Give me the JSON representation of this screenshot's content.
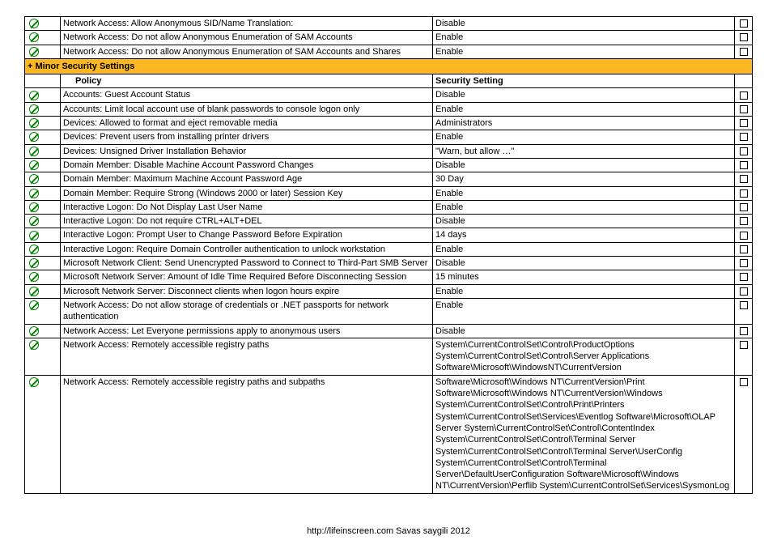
{
  "topRows": [
    {
      "policy": "Network Access: Allow Anonymous SID/Name Translation:",
      "setting": "Disable"
    },
    {
      "policy": "Network Access: Do not allow Anonymous Enumeration of SAM Accounts",
      "setting": "Enable"
    },
    {
      "policy": "Network Access: Do not allow Anonymous Enumeration of SAM Accounts and Shares",
      "setting": "Enable"
    }
  ],
  "sectionHeader": "+ Minor Security Settings",
  "subHeader": {
    "policy": "Policy",
    "setting": "Security Setting"
  },
  "rows": [
    {
      "policy": "Accounts: Guest Account Status",
      "setting": "Disable"
    },
    {
      "policy": "Accounts: Limit local account use of blank passwords to console logon only",
      "setting": "Enable"
    },
    {
      "policy": "Devices: Allowed to format and eject removable media",
      "setting": "Administrators"
    },
    {
      "policy": "Devices: Prevent users from installing printer drivers",
      "setting": "Enable"
    },
    {
      "policy": "Devices: Unsigned Driver Installation Behavior",
      "setting": "\"Warn, but allow …\""
    },
    {
      "policy": "Domain Member: Disable Machine Account Password Changes",
      "setting": "Disable"
    },
    {
      "policy": "Domain Member: Maximum Machine Account Password Age",
      "setting": "30 Day"
    },
    {
      "policy": "Domain Member: Require Strong (Windows 2000 or later) Session Key",
      "setting": "Enable"
    },
    {
      "policy": "Interactive Logon: Do Not Display Last User Name",
      "setting": "Enable"
    },
    {
      "policy": "Interactive Logon: Do not require CTRL+ALT+DEL",
      "setting": "Disable"
    },
    {
      "policy": "Interactive Logon: Prompt User to Change Password Before Expiration",
      "setting": "14 days"
    },
    {
      "policy": "Interactive Logon: Require Domain Controller authentication to unlock workstation",
      "setting": "Enable"
    },
    {
      "policy": "Microsoft Network Client: Send Unencrypted Password to Connect to Third-Part SMB Server",
      "setting": "Disable"
    },
    {
      "policy": "Microsoft Network Server: Amount of Idle Time Required Before Disconnecting Session",
      "setting": "15 minutes"
    },
    {
      "policy": "Microsoft Network Server: Disconnect clients when logon hours expire",
      "setting": "Enable"
    },
    {
      "policy": "Network Access: Do not allow storage of credentials or .NET passports for network authentication",
      "setting": "Enable"
    },
    {
      "policy": "Network Access: Let Everyone permissions apply to anonymous users",
      "setting": "Disable"
    },
    {
      "policy": "Network Access: Remotely accessible registry paths",
      "setting": "System\\CurrentControlSet\\Control\\ProductOptions System\\CurrentControlSet\\Control\\Server Applications Software\\Microsoft\\WindowsNT\\CurrentVersion"
    },
    {
      "policy": "Network Access: Remotely accessible registry paths and subpaths",
      "setting": "Software\\Microsoft\\Windows NT\\CurrentVersion\\Print Software\\Microsoft\\Windows NT\\CurrentVersion\\Windows System\\CurrentControlSet\\Control\\Print\\Printers System\\CurrentControlSet\\Services\\Eventlog Software\\Microsoft\\OLAP Server System\\CurrentControlSet\\Control\\ContentIndex System\\CurrentControlSet\\Control\\Terminal Server System\\CurrentControlSet\\Control\\Terminal Server\\UserConfig System\\CurrentControlSet\\Control\\Terminal Server\\DefaultUserConfiguration Software\\Microsoft\\Windows NT\\CurrentVersion\\Perflib System\\CurrentControlSet\\Services\\SysmonLog"
    }
  ],
  "footer": "http://lifeinscreen.com  Savas saygili 2012"
}
